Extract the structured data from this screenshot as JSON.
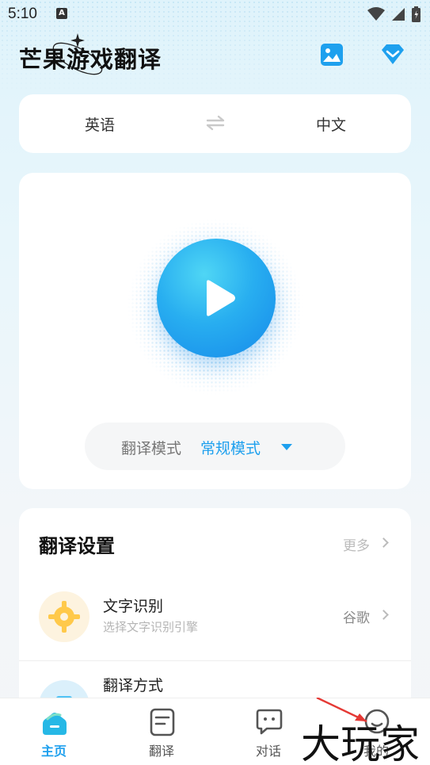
{
  "status_bar": {
    "time": "5:10",
    "badge": "A"
  },
  "header": {
    "title": "芒果游戏翻译",
    "image_icon": "image-icon",
    "vip_icon": "diamond-icon"
  },
  "language": {
    "source": "英语",
    "target": "中文",
    "swap_icon": "swap-arrows-icon"
  },
  "player": {
    "play_icon": "play-icon",
    "mode_label": "翻译模式",
    "mode_value": "常规模式",
    "accent": "#1ea0ee"
  },
  "settings": {
    "title": "翻译设置",
    "more": "更多",
    "items": [
      {
        "title": "文字识别",
        "subtitle": "选择文字识别引擎",
        "value": "谷歌",
        "icon": "target-icon"
      },
      {
        "title": "翻译方式",
        "subtitle": "",
        "value": "",
        "icon": "translate-mode-icon"
      }
    ]
  },
  "nav": {
    "items": [
      {
        "label": "主页",
        "icon": "home-icon",
        "active": true
      },
      {
        "label": "翻译",
        "icon": "document-icon",
        "active": false
      },
      {
        "label": "对话",
        "icon": "chat-icon",
        "active": false
      },
      {
        "label": "我的",
        "icon": "profile-icon",
        "active": false
      }
    ]
  },
  "watermark": {
    "text": "大玩家"
  }
}
